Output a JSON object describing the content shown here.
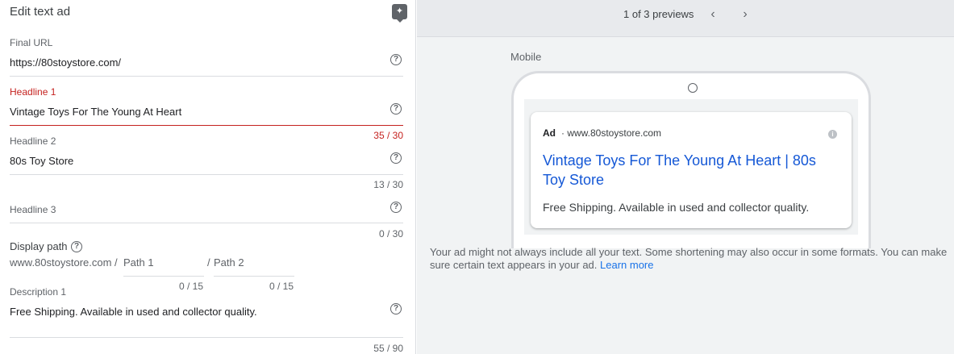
{
  "editor": {
    "title": "Edit text ad",
    "sparkle_icon": "sparkle-icon",
    "final_url": {
      "label": "Final URL",
      "value": "https://80stoystore.com/"
    },
    "headline1": {
      "label": "Headline 1",
      "value": "Vintage Toys For The Young At Heart",
      "count": "35 / 30"
    },
    "headline2": {
      "label": "Headline 2",
      "value": "80s Toy Store",
      "count": "13 / 30"
    },
    "headline3": {
      "label": "Headline 3",
      "value": "",
      "count": "0 / 30"
    },
    "display_path": {
      "label": "Display path",
      "base": "www.80stoystore.com /",
      "path1_placeholder": "Path 1",
      "path1_count": "0 / 15",
      "separator": "/",
      "path2_placeholder": "Path 2",
      "path2_count": "0 / 15"
    },
    "description1": {
      "label": "Description 1",
      "value": "Free Shipping. Available in used and collector quality.",
      "count": "55 / 90"
    },
    "help_glyph": "?"
  },
  "preview": {
    "counter": "1 of 3 previews",
    "prev_icon": "chevron-left-icon",
    "next_icon": "chevron-right-icon",
    "device_label": "Mobile",
    "ad": {
      "tag": "Ad",
      "url": "· www.80stoystore.com",
      "headline": "Vintage Toys For The Young At Heart | 80s Toy Store",
      "description": "Free Shipping. Available in used and collector quality."
    },
    "note": "Your ad might not always include all your text. Some shortening may also occur in some formats. You can make sure certain text appears in your ad.",
    "note_link": "Learn more"
  },
  "colors": {
    "error": "#c5221f",
    "link": "#1558d6",
    "accent": "#1a73e8"
  }
}
